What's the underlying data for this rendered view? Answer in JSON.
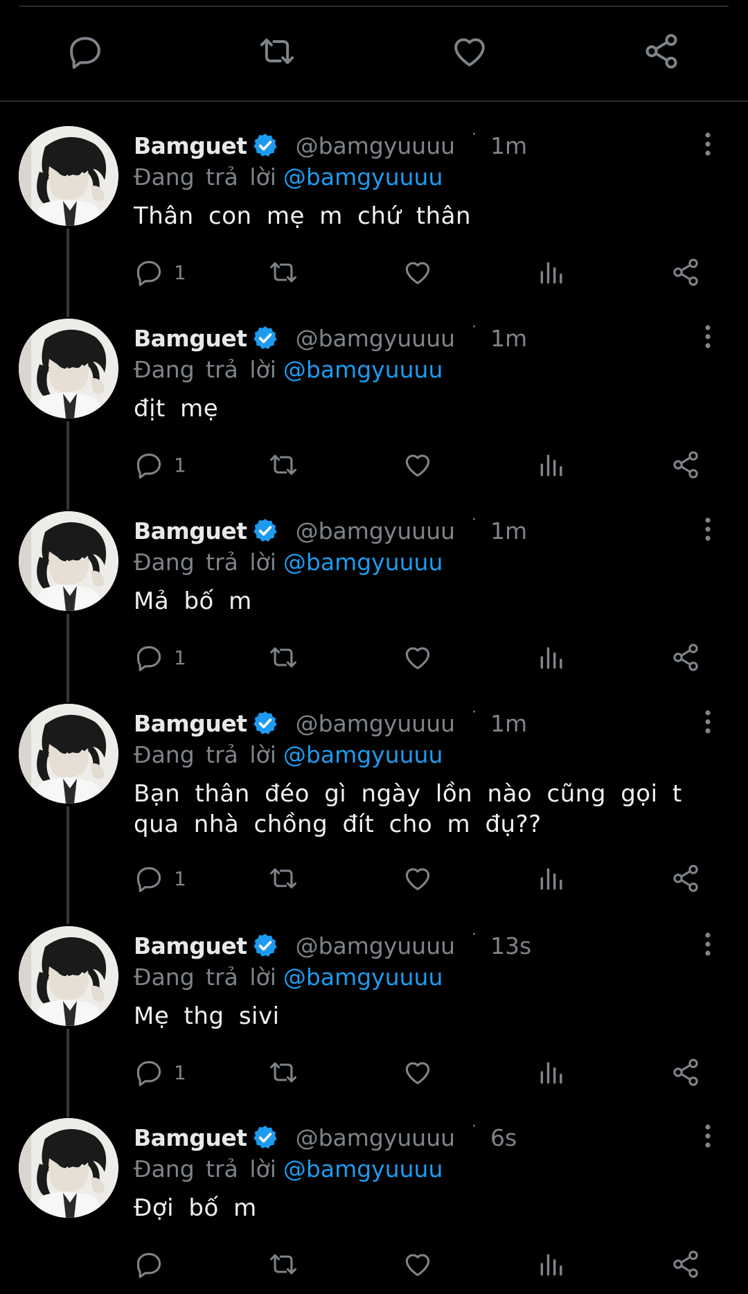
{
  "colors": {
    "background": "#000000",
    "icon_gray": "#7f848a",
    "mention_blue": "#1d9bf0",
    "verified_blue": "#1d9bf0"
  },
  "top_actions": [
    {
      "name": "reply",
      "icon": "comment-icon"
    },
    {
      "name": "retweet",
      "icon": "retweet-icon"
    },
    {
      "name": "like",
      "icon": "heart-icon"
    },
    {
      "name": "share",
      "icon": "share-icon"
    }
  ],
  "replies": [
    {
      "name": "Bamguet",
      "handle": "@bamgyuuuu",
      "time": "1m",
      "replying_label": "Đang trả lời",
      "replying_to": "@bamgyuuuu",
      "text": "Thân con mẹ m chứ thân",
      "reply_count": "1"
    },
    {
      "name": "Bamguet",
      "handle": "@bamgyuuuu",
      "time": "1m",
      "replying_label": "Đang trả lời",
      "replying_to": "@bamgyuuuu",
      "text": "địt mẹ",
      "reply_count": "1"
    },
    {
      "name": "Bamguet",
      "handle": "@bamgyuuuu",
      "time": "1m",
      "replying_label": "Đang trả lời",
      "replying_to": "@bamgyuuuu",
      "text": "Mả bố m",
      "reply_count": "1"
    },
    {
      "name": "Bamguet",
      "handle": "@bamgyuuuu",
      "time": "1m",
      "replying_label": "Đang trả lời",
      "replying_to": "@bamgyuuuu",
      "text": "Bạn thân đéo gì ngày lồn nào cũng gọi t qua nhà chồng đít cho m đụ??",
      "reply_count": "1"
    },
    {
      "name": "Bamguet",
      "handle": "@bamgyuuuu",
      "time": "13s",
      "replying_label": "Đang trả lời",
      "replying_to": "@bamgyuuuu",
      "text": "Mẹ thg sivi",
      "reply_count": "1"
    },
    {
      "name": "Bamguet",
      "handle": "@bamgyuuuu",
      "time": "6s",
      "replying_label": "Đang trả lời",
      "replying_to": "@bamgyuuuu",
      "text": "Đợi bố m",
      "reply_count": ""
    }
  ]
}
